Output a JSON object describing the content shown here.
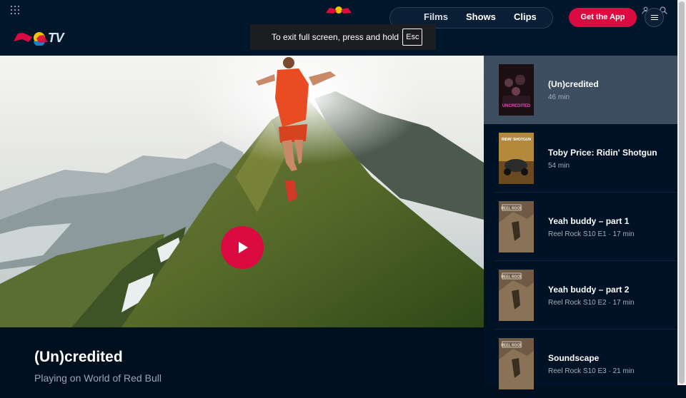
{
  "header": {
    "logo_text": "TV",
    "nav": [
      {
        "label": "Films"
      },
      {
        "label": "Shows"
      },
      {
        "label": "Clips"
      }
    ],
    "cta_label": "Get the App"
  },
  "fullscreen_notice": {
    "text": "To exit full screen, press and hold",
    "key": "Esc"
  },
  "hero": {
    "title": "(Un)credited",
    "subtitle": "Playing on World of Red Bull"
  },
  "playlist": [
    {
      "title": "(Un)credited",
      "meta": "46 min",
      "thumb_label": "UNCREDITED"
    },
    {
      "title": "Toby Price: Ridin' Shotgun",
      "meta": "54 min",
      "thumb_label": "RIDIN' SHOTGUN"
    },
    {
      "title": "Yeah buddy – part 1",
      "meta": "Reel Rock S10 E1 · 17 min",
      "thumb_label": "REEL ROCK"
    },
    {
      "title": "Yeah buddy – part 2",
      "meta": "Reel Rock S10 E2 · 17 min",
      "thumb_label": "REEL ROCK"
    },
    {
      "title": "Soundscape",
      "meta": "Reel Rock S10 E3 · 21 min",
      "thumb_label": "REEL ROCK"
    }
  ],
  "icons": {
    "apps": "grid-icon",
    "account": "user-icon",
    "search": "search-icon",
    "menu": "hamburger-icon",
    "play": "play-icon"
  },
  "colors": {
    "accent": "#db0a40",
    "background": "#000f1e",
    "active_item": "#3c4e60"
  }
}
